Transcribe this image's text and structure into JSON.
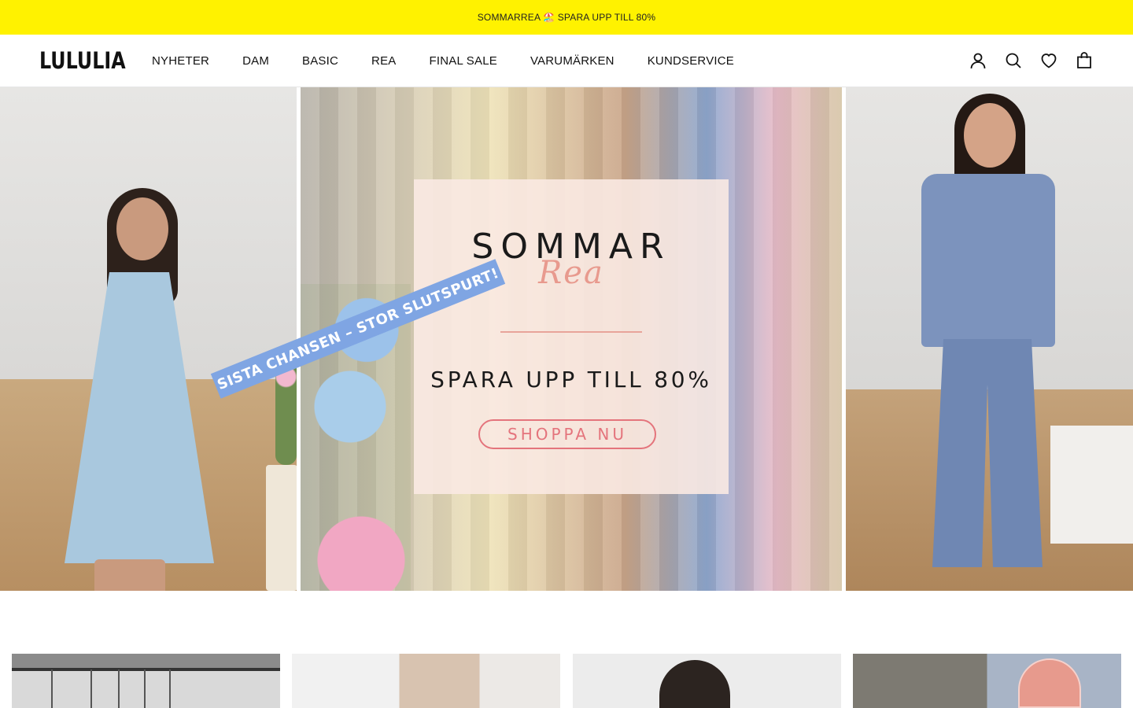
{
  "announcement": {
    "text": "SOMMARREA 🏖️ SPARA UPP TILL 80%"
  },
  "header": {
    "logo": "LULULIA",
    "nav": [
      {
        "label": "NYHETER"
      },
      {
        "label": "DAM"
      },
      {
        "label": "BASIC"
      },
      {
        "label": "REA"
      },
      {
        "label": "FINAL SALE"
      },
      {
        "label": "VARUMÄRKEN"
      },
      {
        "label": "KUNDSERVICE"
      }
    ],
    "icons": [
      "account-icon",
      "search-icon",
      "wishlist-heart-icon",
      "cart-bag-icon"
    ]
  },
  "hero": {
    "ribbon": "SISTA CHANSEN – STOR SLUTSPURT!",
    "title": "SOMMAR",
    "script": "Rea",
    "subtitle": "SPARA UPP TILL 80%",
    "button": "SHOPPA NU",
    "colors": {
      "ribbon": "#7fa5e3",
      "button": "#e4747c",
      "card": "#f9e9e2"
    }
  },
  "colors": {
    "announcement_bg": "#fff200",
    "text": "#111111"
  }
}
